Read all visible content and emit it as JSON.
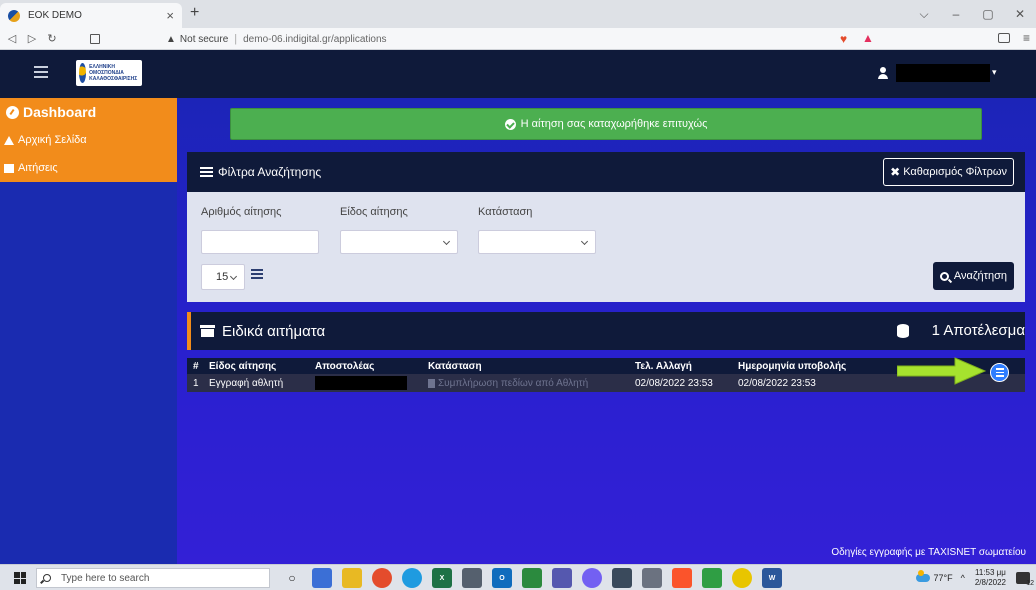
{
  "browser": {
    "tab_title": "EOK DEMO",
    "tab_close": "×",
    "new_tab": "+",
    "security_label": "Not secure",
    "url": "demo-06.indigital.gr/applications",
    "window_controls": {
      "minimize": "–",
      "maximize": "▢",
      "close": "✕",
      "tabs_dropdown": "⌵"
    }
  },
  "app": {
    "logo_text": "ΕΛΛΗΝΙΚΗ ΟΜΟΣΠΟΝΔΙΑ ΚΑΛΑΘΟΣΦΑΙΡΙΣΗΣ",
    "user_caret": "▾"
  },
  "sidebar": {
    "dashboard_label": "Dashboard",
    "items": [
      {
        "label": "Αρχική Σελίδα",
        "icon": "home-icon"
      },
      {
        "label": "Αιτήσεις",
        "icon": "folder-icon"
      }
    ]
  },
  "alert": {
    "message": "Η αίτηση σας καταχωρήθηκε επιτυχώς"
  },
  "filters": {
    "title": "Φίλτρα Αναζήτησης",
    "clear_label": "Καθαρισμός Φίλτρων",
    "fields": {
      "application_number_label": "Αριθμός αίτησης",
      "application_type_label": "Είδος αίτησης",
      "status_label": "Κατάσταση"
    },
    "per_page": "15",
    "search_label": "Αναζήτηση"
  },
  "results": {
    "title": "Ειδικά αιτήματα",
    "count": "1 Αποτέλεσμα",
    "columns": [
      "#",
      "Είδος αίτησης",
      "Αποστολέας",
      "Κατάσταση",
      "Τελ. Αλλαγή",
      "Ημερομηνία υποβολής"
    ],
    "rows": [
      {
        "index": "1",
        "type": "Εγγραφή αθλητή",
        "status": "Συμπλήρωση πεδίων από Αθλητή",
        "last_change": "02/08/2022 23:53",
        "submitted": "02/08/2022 23:53"
      }
    ]
  },
  "footer": {
    "taxisnet_link": "Οδηγίες εγγραφής με TAXISNET σωματείου"
  },
  "taskbar": {
    "search_placeholder": "Type here to search",
    "temperature": "77°F",
    "chevron": "^",
    "time": "11:53 μμ",
    "date": "2/8/2022",
    "notification_count": "12"
  },
  "colors": {
    "navbar": "#0f1a3a",
    "sidebar": "#1a2bb0",
    "accent_orange": "#f28c1b",
    "alert_green": "#4caf50",
    "view_button": "#2f7dff",
    "arrow_green": "#a6e22e"
  }
}
